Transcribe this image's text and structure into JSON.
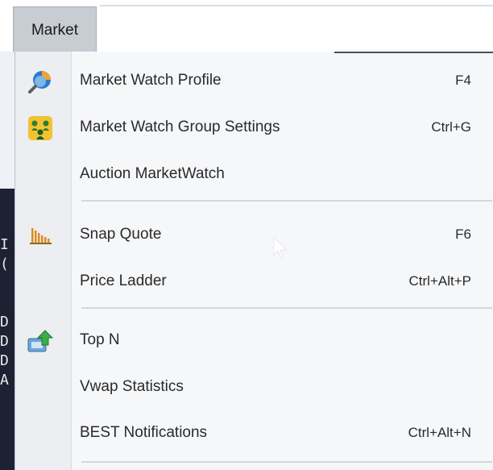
{
  "menubar": {
    "active_menu": "Market"
  },
  "background": {
    "left_glyphs": [
      "I",
      "(",
      "",
      "",
      "D",
      "D",
      "D",
      "A",
      ""
    ]
  },
  "dropdown": {
    "items": [
      {
        "label": "Market Watch Profile",
        "shortcut": "F4",
        "icon": "market-watch-profile-icon"
      },
      {
        "label": "Market Watch Group Settings",
        "shortcut": "Ctrl+G",
        "icon": "group-settings-icon"
      },
      {
        "label": "Auction MarketWatch",
        "shortcut": "",
        "icon": ""
      },
      {
        "label": "Snap Quote",
        "shortcut": "F6",
        "icon": "snap-quote-chart-icon"
      },
      {
        "label": "Price Ladder",
        "shortcut": "Ctrl+Alt+P",
        "icon": ""
      },
      {
        "label": "Top N",
        "shortcut": "",
        "icon": "top-n-icon"
      },
      {
        "label": "Vwap Statistics",
        "shortcut": "",
        "icon": ""
      },
      {
        "label": "BEST Notifications",
        "shortcut": "Ctrl+Alt+N",
        "icon": ""
      }
    ]
  },
  "colors": {
    "menu_background": "#f6f7f9",
    "icon_column": "#eceef1",
    "active_tab": "#c8ccd3",
    "separator": "#d4d7dc",
    "text": "#2a2a2a"
  }
}
